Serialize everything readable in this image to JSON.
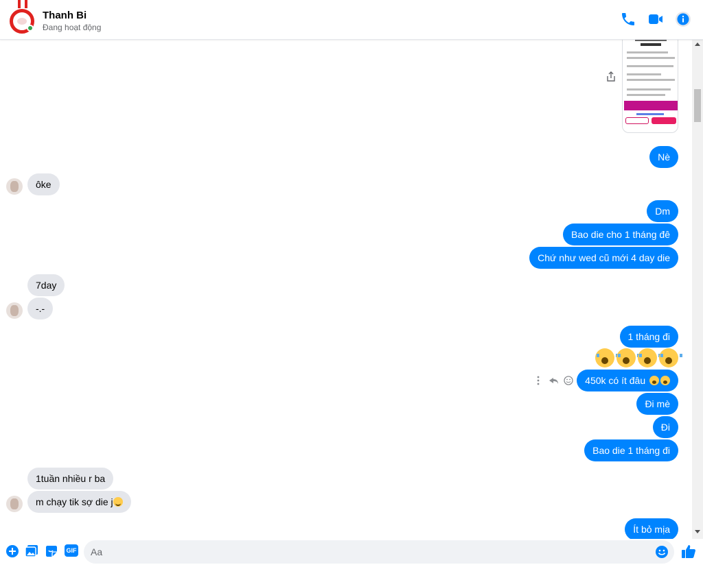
{
  "header": {
    "contact_name": "Thanh Bi",
    "status": "Đang hoạt động",
    "icons": [
      "phone-icon",
      "video-call-icon",
      "info-icon"
    ],
    "accent_color": "#0084ff"
  },
  "messages": [
    {
      "side": "out",
      "kind": "image",
      "desc": "screenshot"
    },
    {
      "side": "out",
      "text": "Nè"
    },
    {
      "side": "in",
      "text": "ôke"
    },
    {
      "side": "out",
      "text": "Dm"
    },
    {
      "side": "out",
      "text": "Bao die cho 1 tháng đê"
    },
    {
      "side": "out",
      "text": "Chứ như wed cũ mới 4 day die"
    },
    {
      "side": "in",
      "text": "7day"
    },
    {
      "side": "in",
      "text": "-.-"
    },
    {
      "side": "out",
      "text": "1 tháng đi"
    },
    {
      "side": "out",
      "kind": "emoji",
      "emoji": "crying-face x4"
    },
    {
      "side": "out",
      "text": "450k có ít đâu"
    },
    {
      "side": "out",
      "text": "Đi mè"
    },
    {
      "side": "out",
      "text": "Đi"
    },
    {
      "side": "out",
      "text": "Bao die 1 tháng đi"
    },
    {
      "side": "in",
      "text": "1tuần nhiều r ba"
    },
    {
      "side": "in",
      "text": "m chạy tik sợ die j"
    },
    {
      "side": "out",
      "text": "Ít bỏ mịa"
    }
  ],
  "composer": {
    "placeholder": "Aa",
    "icons": [
      "plus-icon",
      "image-icon",
      "sticker-icon",
      "gif-icon",
      "emoji-icon",
      "like-icon"
    ],
    "gif_label": "GIF"
  }
}
